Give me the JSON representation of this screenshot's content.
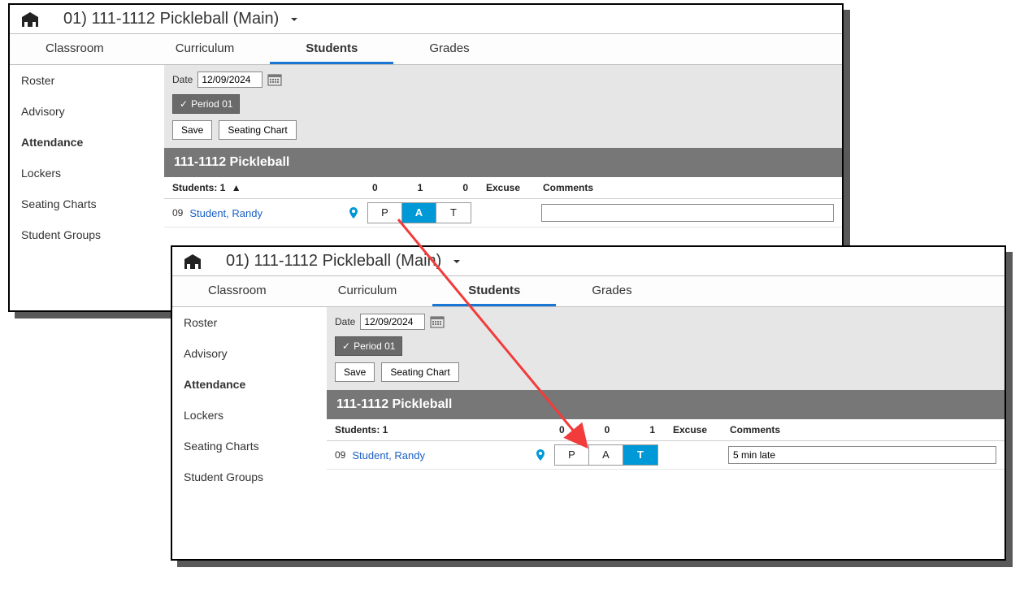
{
  "windows": {
    "before": {
      "title": "01) 111-1112 Pickleball (Main)",
      "tabs": [
        "Classroom",
        "Curriculum",
        "Students",
        "Grades"
      ],
      "activeTab": "Students",
      "sidebar": [
        "Roster",
        "Advisory",
        "Attendance",
        "Lockers",
        "Seating Charts",
        "Student Groups"
      ],
      "activeSidebar": "Attendance",
      "toolbar": {
        "dateLabel": "Date",
        "date": "12/09/2024",
        "period": "Period 01",
        "save": "Save",
        "seating": "Seating Chart"
      },
      "classBar": "111-1112 Pickleball",
      "head": {
        "studentsLabel": "Students: 1",
        "p": "0",
        "a": "1",
        "t": "0",
        "excuse": "Excuse",
        "comments": "Comments"
      },
      "row": {
        "seat": "09",
        "student": "Student, Randy",
        "P": "P",
        "A": "A",
        "T": "T",
        "selected": "A",
        "comment": ""
      }
    },
    "after": {
      "title": "01) 111-1112 Pickleball (Main)",
      "tabs": [
        "Classroom",
        "Curriculum",
        "Students",
        "Grades"
      ],
      "activeTab": "Students",
      "sidebar": [
        "Roster",
        "Advisory",
        "Attendance",
        "Lockers",
        "Seating Charts",
        "Student Groups"
      ],
      "activeSidebar": "Attendance",
      "toolbar": {
        "dateLabel": "Date",
        "date": "12/09/2024",
        "period": "Period 01",
        "save": "Save",
        "seating": "Seating Chart"
      },
      "classBar": "111-1112 Pickleball",
      "head": {
        "studentsLabel": "Students: 1",
        "p": "0",
        "a": "0",
        "t": "1",
        "excuse": "Excuse",
        "comments": "Comments"
      },
      "row": {
        "seat": "09",
        "student": "Student, Randy",
        "P": "P",
        "A": "A",
        "T": "T",
        "selected": "T",
        "comment": "5 min late"
      }
    }
  }
}
